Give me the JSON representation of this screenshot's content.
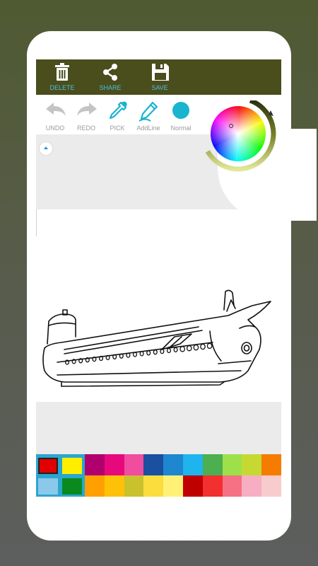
{
  "toolbar": {
    "delete_label": "DELETE",
    "share_label": "SHARE",
    "save_label": "SAVE"
  },
  "tools": {
    "undo_label": "UNDO",
    "redo_label": "REDO",
    "pick_label": "PICK",
    "addline_label": "AddLine",
    "normal_label": "Normal"
  },
  "colors": {
    "toolbar_bg": "#4a4d1c",
    "accent": "#4ec0e0",
    "current_color": "#1ab4cf"
  },
  "palette": {
    "selected": [
      {
        "name": "primary",
        "color": "#e00000"
      },
      {
        "name": "secondary",
        "color": "#ffee00"
      },
      {
        "name": "tertiary",
        "color": "#8cc8ea"
      },
      {
        "name": "quaternary",
        "color": "#0a8a1e"
      }
    ],
    "row1": [
      "#b0006e",
      "#e8087e",
      "#f04ca0",
      "#1b4fa0",
      "#1f86d0",
      "#20b4ee",
      "#4caf50",
      "#9ee04a",
      "#c6d932",
      "#f57c00"
    ],
    "row2": [
      "#ffa000",
      "#ffc107",
      "#c9c12e",
      "#fbdd3e",
      "#fff176",
      "#c00000",
      "#f23030",
      "#f57184",
      "#f7aec3",
      "#f8cccc"
    ]
  },
  "icons": [
    "trash-icon",
    "share-icon",
    "save-icon",
    "undo-icon",
    "redo-icon",
    "eyedropper-icon",
    "pencil-icon",
    "brush-circle-icon",
    "color-wheel-icon",
    "collapse-arrow-icon"
  ]
}
